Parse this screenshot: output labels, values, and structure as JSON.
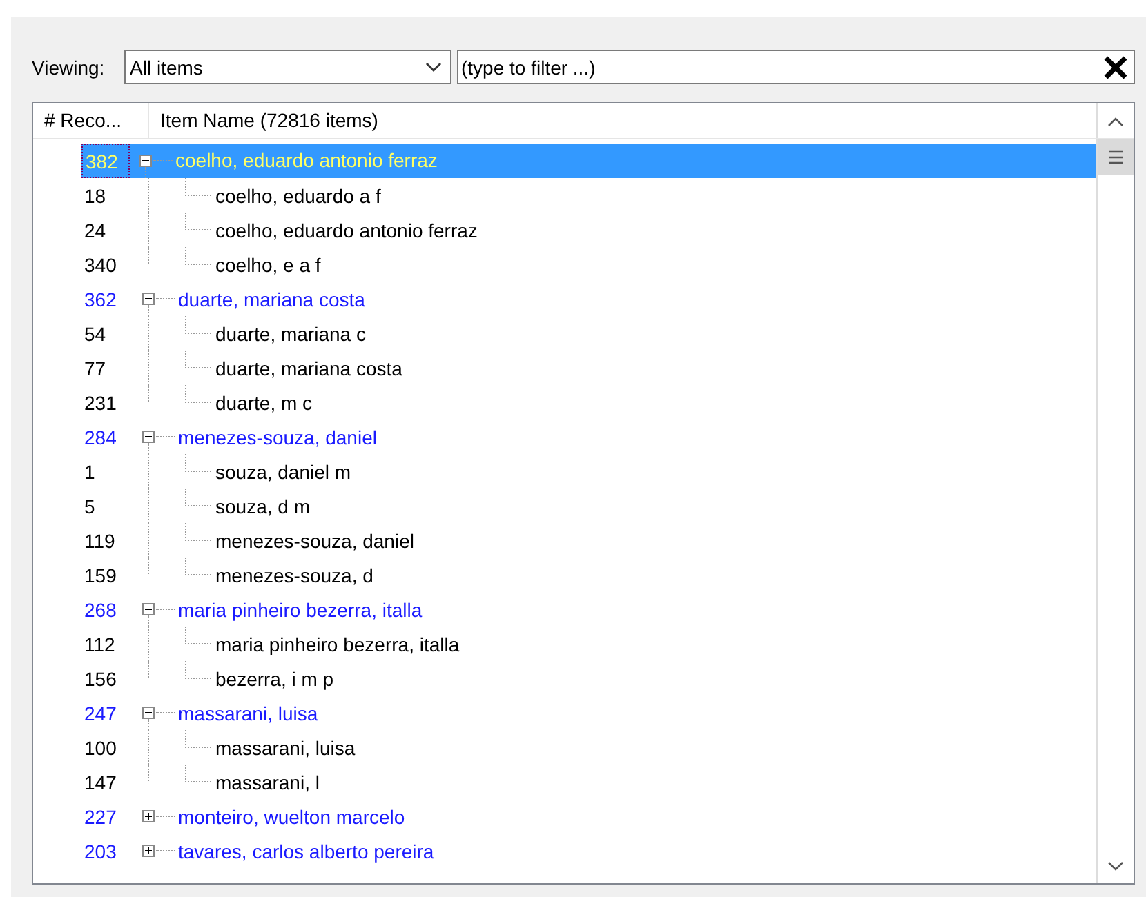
{
  "viewing": {
    "label": "Viewing:",
    "value": "All items"
  },
  "filter": {
    "placeholder": "(type to filter ...)"
  },
  "tree": {
    "columns": [
      "# Reco...",
      "Item Name (72816 items)"
    ],
    "items": [
      {
        "count": "382",
        "name": "coelho, eduardo antonio ferraz",
        "expanded": true,
        "selected": true,
        "children": [
          {
            "count": "18",
            "name": "coelho, eduardo a f",
            "selected": false
          },
          {
            "count": "24",
            "name": "coelho, eduardo antonio ferraz",
            "selected": false
          },
          {
            "count": "340",
            "name": "coelho, e a f",
            "selected": false
          }
        ]
      },
      {
        "count": "362",
        "name": "duarte, mariana costa",
        "expanded": true,
        "selected": false,
        "children": [
          {
            "count": "54",
            "name": "duarte, mariana c",
            "selected": false
          },
          {
            "count": "77",
            "name": "duarte, mariana costa",
            "selected": false
          },
          {
            "count": "231",
            "name": "duarte, m c",
            "selected": false
          }
        ]
      },
      {
        "count": "284",
        "name": "menezes-souza, daniel",
        "expanded": true,
        "selected": false,
        "children": [
          {
            "count": "1",
            "name": "souza, daniel m",
            "selected": false
          },
          {
            "count": "5",
            "name": "souza, d m",
            "selected": false
          },
          {
            "count": "119",
            "name": "menezes-souza, daniel",
            "selected": false
          },
          {
            "count": "159",
            "name": "menezes-souza, d",
            "selected": false
          }
        ]
      },
      {
        "count": "268",
        "name": "maria pinheiro bezerra, italla",
        "expanded": true,
        "selected": false,
        "children": [
          {
            "count": "112",
            "name": "maria pinheiro bezerra, italla",
            "selected": false
          },
          {
            "count": "156",
            "name": "bezerra, i m p",
            "selected": false
          }
        ]
      },
      {
        "count": "247",
        "name": "massarani, luisa",
        "expanded": true,
        "selected": false,
        "children": [
          {
            "count": "100",
            "name": "massarani, luisa",
            "selected": false
          },
          {
            "count": "147",
            "name": "massarani, l",
            "selected": false
          }
        ]
      },
      {
        "count": "227",
        "name": "monteiro, wuelton marcelo",
        "expanded": false,
        "selected": false
      },
      {
        "count": "203",
        "name": "tavares, carlos alberto pereira",
        "expanded": false,
        "selected": false
      }
    ]
  }
}
